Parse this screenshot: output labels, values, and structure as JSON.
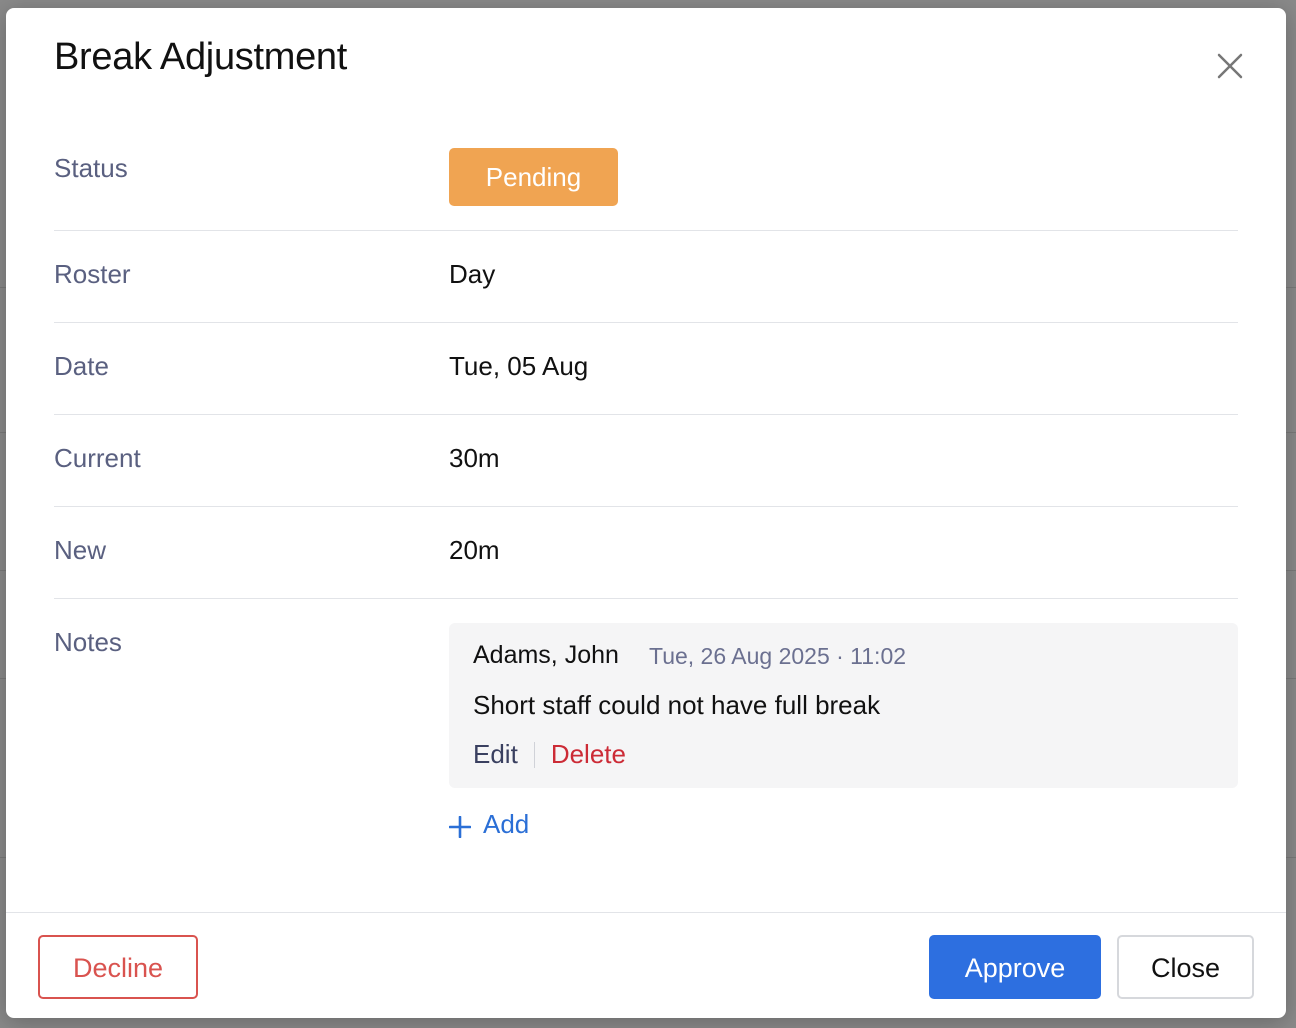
{
  "dialog": {
    "title": "Break Adjustment"
  },
  "fields": {
    "status_label": "Status",
    "status_value": "Pending",
    "roster_label": "Roster",
    "roster_value": "Day",
    "date_label": "Date",
    "date_value": "Tue, 05 Aug",
    "current_label": "Current",
    "current_value": "30m",
    "new_label": "New",
    "new_value": "20m",
    "notes_label": "Notes"
  },
  "note": {
    "author": "Adams, John",
    "timestamp": "Tue, 26 Aug 2025 · 11:02",
    "text": "Short staff could not have full break",
    "edit_label": "Edit",
    "delete_label": "Delete"
  },
  "add_label": "Add",
  "footer": {
    "decline_label": "Decline",
    "approve_label": "Approve",
    "close_label": "Close"
  },
  "colors": {
    "status_pending": "#f0a452",
    "primary": "#2d6fe0",
    "danger": "#d9534f",
    "link": "#2b6fd6"
  }
}
